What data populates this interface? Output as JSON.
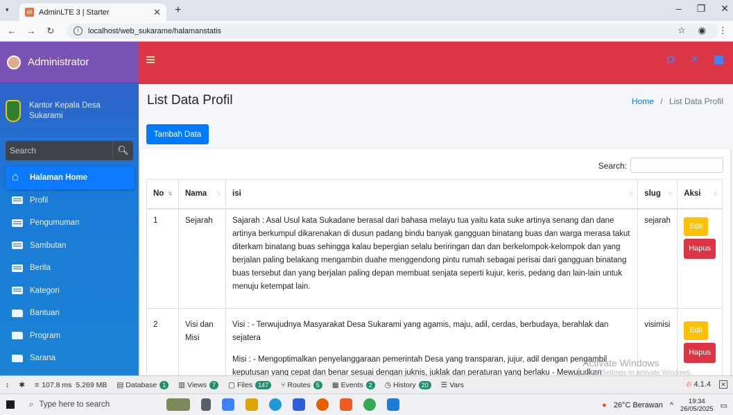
{
  "browser": {
    "tab_title": "AdminLTE 3 | Starter",
    "url": "localhost/web_sukarame/halamanstatis"
  },
  "sidebar": {
    "brand": "Administrator",
    "user_name": "Kantor Kepala Desa Sukarami",
    "search_placeholder": "Search",
    "items": [
      {
        "label": "Halaman Home",
        "icon": "home-icon",
        "active": true
      },
      {
        "label": "Profil",
        "icon": "table-icon"
      },
      {
        "label": "Pengumuman",
        "icon": "table-icon"
      },
      {
        "label": "Sambutan",
        "icon": "table-icon"
      },
      {
        "label": "Berita",
        "icon": "table-icon"
      },
      {
        "label": "Kategori",
        "icon": "table-icon"
      },
      {
        "label": "Bantuan",
        "icon": "folder-icon"
      },
      {
        "label": "Program",
        "icon": "folder-icon"
      },
      {
        "label": "Sarana",
        "icon": "folder-icon"
      }
    ]
  },
  "header": {
    "title": "List Data Profil",
    "breadcrumb_home": "Home",
    "breadcrumb_sep": "/",
    "breadcrumb_current": "List Data Profil"
  },
  "toolbar": {
    "add_label": "Tambah Data",
    "search_label": "Search:"
  },
  "table": {
    "columns": [
      "No",
      "Nama",
      "isi",
      "slug",
      "Aksi"
    ],
    "rows": [
      {
        "no": "1",
        "nama": "Sejarah",
        "isi": [
          "Sajarah : Asal Usul kata Sukadane berasal dari bahasa melayu tua yaitu kata suke artinya senang dan dane artinya berkumpul dikarenakan di dusun padang bindu banyak gangguan binatang buas dan warga merasa takut diterkam binatang buas sehingga kalau bepergian selalu beriringan dan dan berkelompok-kelompok dan yang berjalan paling belakang mengambin duahe menggendong pintu rumah sebagai perisai dari gangguan binatang buas tersebut dan yang berjalan paling depan membuat senjata seperti kujur, keris, pedang dan lain-lain untuk menuju ketempat lain."
        ],
        "slug": "sejarah",
        "edit": "Edit",
        "hapus": "Hapus"
      },
      {
        "no": "2",
        "nama": "Visi dan Misi",
        "isi": [
          "Visi : - Terwujudnya Masyarakat Desa Sukarami yang agamis, maju, adil, cerdas, berbudaya, berahlak dan sejatera",
          "Misi : - Mengoptimalkan penyelanggaraan pemerintah Desa yang transparan, jujur, adil dengan pengambil keputusan yang cepat dan benar sesuai dengan juknis, juklak dan peraturan yang berlaku - Mewujudkan"
        ],
        "slug": "visimisi",
        "edit": "Edit",
        "hapus": "Hapus"
      }
    ]
  },
  "watermark": {
    "title": "Activate Windows",
    "subtitle": "Go to Settings to activate Windows."
  },
  "debugbar": {
    "time": "107.8 ms",
    "memory": "5.269 MB",
    "items": [
      {
        "label": "Database",
        "count": "1"
      },
      {
        "label": "Views",
        "count": "7"
      },
      {
        "label": "Files",
        "count": "147"
      },
      {
        "label": "Routes",
        "count": "5"
      },
      {
        "label": "Events",
        "count": "2"
      },
      {
        "label": "History",
        "count": "20"
      },
      {
        "label": "Vars",
        "count": ""
      }
    ],
    "version": "4.1.4"
  },
  "taskbar": {
    "search_placeholder": "Type here to search",
    "weather": "26°C Berawan",
    "time": "19:34",
    "date": "26/05/2025"
  }
}
